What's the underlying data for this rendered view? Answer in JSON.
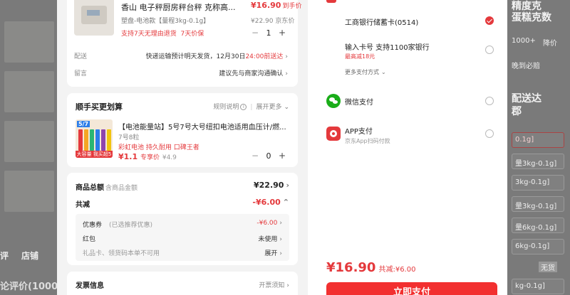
{
  "background": {
    "left_tabs": [
      "评",
      "店铺"
    ],
    "left_bottom": "论评价(1000+",
    "right_lines": [
      "精度克",
      "蛋糕克数",
      "1000+",
      "降价",
      "晚到必赔",
      "配送达",
      "郡"
    ],
    "right_chips": [
      "0.1g]",
      "量3kg-0.1g]",
      "3kg-0.1g]",
      "量3kg-0.1g]",
      "量6kg-0.1g]",
      "6kg-0.1g]",
      "kg-0.1g]"
    ],
    "right_badge": "无货"
  },
  "product": {
    "title": "香山 电子秤厨房秤台秤 克称高...",
    "price": "¥16.90",
    "price_note": "到手价",
    "spec": "塑盘-电池款【量程3kg-0.1g】",
    "original_price": "¥22.90 京东价",
    "promise_a": "支持7天无理由退货",
    "promise_b": "7天价保",
    "quantity": "1",
    "minus": "−",
    "plus": "+"
  },
  "delivery": {
    "label": "配送",
    "value": "快递运输预计明天发货，12月30日",
    "highlight": "24:00前送达"
  },
  "note": {
    "label": "留言",
    "value": "建议先与商家沟通确认"
  },
  "addon": {
    "title": "顺手买更划算",
    "rules": "规则说明",
    "more": "展开更多",
    "item_title": "【电池能量站】5号7号大号纽扣电池适用血压计/燃...",
    "item_spec": "7号8粒",
    "item_tags": "彩虹电池 持久耐用 口碑王者",
    "item_price": "¥1.1",
    "item_price_note": "专享价",
    "item_orig": "¥4.9",
    "item_badge": "5/7",
    "item_img_tag": "大容量 我买超5折",
    "quantity": "0"
  },
  "summary": {
    "total_label": "商品总额",
    "total_sub": "含商品金额",
    "total_value": "¥22.90",
    "discount_label": "共减",
    "discount_value": "-¥6.00",
    "coupon_label": "优惠券",
    "coupon_note": "(已选推荐优惠)",
    "coupon_value": "-¥6.00",
    "redpack_label": "红包",
    "redpack_value": "未使用",
    "giftcard_label": "礼品卡、领货码本单不可用",
    "giftcard_value": "展开"
  },
  "invoice": {
    "label": "发票信息",
    "value": "开票须知"
  },
  "payment": {
    "methods": [
      {
        "title": "工商银行储蓄卡(0514)",
        "sub": "",
        "selected": true
      },
      {
        "title": "输入卡号 支持1100家银行",
        "sub": "最高减18元",
        "selected": false
      },
      {
        "title": "微信支付",
        "sub": "",
        "selected": false
      },
      {
        "title": "APP支付",
        "sub": "京东App扫码付款",
        "selected": false
      }
    ],
    "more": "更多支付方式",
    "total": "¥16.90",
    "total_discount": "共减:¥6.00",
    "pay_button": "立即支付"
  },
  "colors": {
    "accent": "#e4393c",
    "wechat": "#1aad19"
  }
}
